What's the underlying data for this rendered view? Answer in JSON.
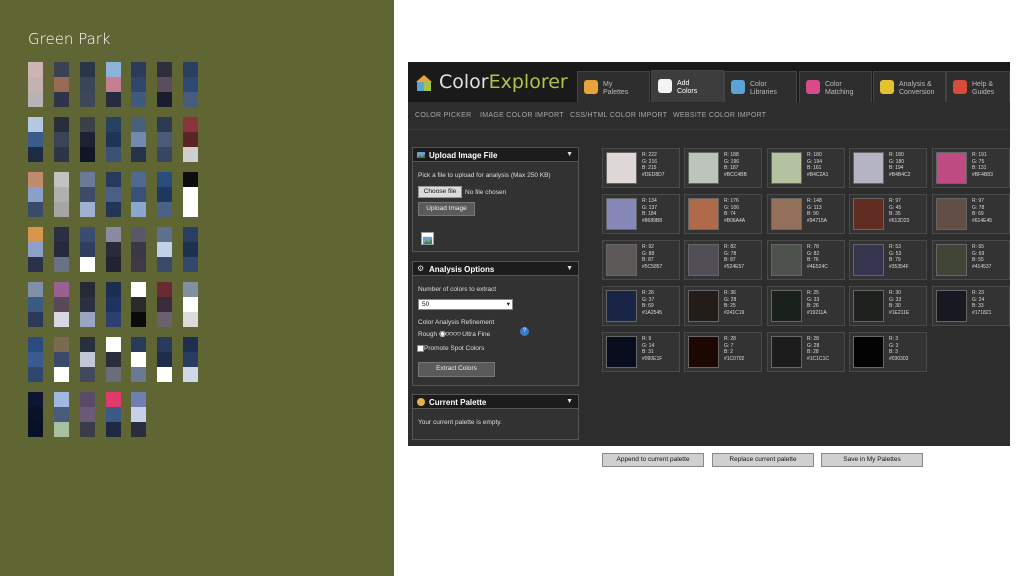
{
  "left_panel": {
    "title": "Green Park",
    "background": "#606534",
    "columns": [
      [
        "#cfb3b3",
        "#c3b2b1",
        "#b7b2b4",
        "#0f1530",
        "#171d3a"
      ],
      [
        "#3a4152",
        "#9a6a55",
        "#2f3549",
        "#30384c",
        "#2a2f40"
      ],
      [
        "#2a3545",
        "#3a4556",
        "#3d4758",
        "#3b3a48",
        "#3f3c4a"
      ],
      [
        "#8db3d8",
        "#c47f93",
        "#262c3e",
        "#ffffff",
        "#f5f5f5"
      ],
      [
        "#2d3a5a",
        "#30466c",
        "#405a7e",
        "#8a8070",
        "#8e8574"
      ],
      [
        "#2d2f3d",
        "#5a4d5d",
        "#1a1e2c",
        "#a28a9a",
        "#9e8898"
      ],
      [
        "#2a3e60",
        "#2c4a73",
        "#495b7c",
        "#f0f0f0",
        "#ececec"
      ],
      [
        "#b5c8e0",
        "#3b5b8c",
        "#1d2b45",
        "#2a3a55",
        "#0d1526"
      ],
      [
        "#2a2e38",
        "#3a4458",
        "#2e3646",
        "#4a5568",
        "#a8b0c0"
      ],
      [
        "#3c4148",
        "#1b2236",
        "#0f1726",
        "#ffffff",
        "#fafafa"
      ],
      [
        "#284064",
        "#1f3555",
        "#3a5275",
        "#162843",
        "#0f1c30"
      ],
      [
        "#4a5f7a",
        "#708ab0",
        "#253448",
        "#1c2738",
        "#2b3a52"
      ],
      [
        "#2e3a50",
        "#4a5a78",
        "#38465f",
        "#6d7a92",
        "#5f6b82"
      ],
      [
        "#8a3338",
        "#5a2429",
        "#cfcfcf",
        "#222222",
        "#1d1d1d"
      ],
      [
        "#c08a6e",
        "#8aa0c8",
        "#3a4a6a",
        "#283448",
        "#1f2a3e"
      ],
      [
        "#c2c2c2",
        "#b0b0b0",
        "#a5a5a5",
        "#1e2432",
        "#161b28"
      ],
      [
        "#6c7a98",
        "#3f4a68",
        "#9fb0d0",
        "#24324c",
        "#1c283e"
      ],
      [
        "#273a5e",
        "#4a5f88",
        "#233557",
        "#ffffff",
        "#f7f7f7"
      ],
      [
        "#4f6a92",
        "#3b5078",
        "#8aa7d0",
        "#0f1a2c",
        "#0b1322"
      ],
      [
        "#284d7a",
        "#1d3a5e",
        "#4a6285",
        "#ffffff",
        "#fafafa"
      ],
      [
        "#0d0d0d",
        "#ffffff",
        "#ffffff",
        "#4a4f5e",
        "#3f4452"
      ],
      [
        "#d9944e",
        "#8ca0c8",
        "#2a3148",
        "#4a4f60",
        "#3f2a4a"
      ],
      [
        "#2a3042",
        "#252a3a",
        "#6c7286",
        "#6a7084",
        "#4a5064"
      ],
      [
        "#3a4d70",
        "#2d3e5e",
        "#ffffff",
        "#2a3854",
        "#1c2a44"
      ],
      [
        "#8a8aa0",
        "#2a2a3a",
        "#222232",
        "#5a4a5a",
        "#7a6a7a"
      ],
      [
        "#5a5868",
        "#3a3848",
        "#403a48",
        "#46404e",
        "#4c4656"
      ],
      [
        "#5e7090",
        "#c0d2e6",
        "#3a4a68",
        "#2a3654",
        "#1e2a46"
      ],
      [
        "#2a3e64",
        "#1e3050",
        "#34476c",
        "#e8e8e8",
        "#e0e0e0"
      ],
      [
        "#8090a8",
        "#3a5a82",
        "#2a3a58",
        "#1e3252",
        "#6a7490"
      ],
      [
        "#9a6090",
        "#58485a",
        "#d8d8e0",
        "#8c8ca0",
        "#ffffff"
      ],
      [
        "#262a36",
        "#2a3040",
        "#9aa5c4",
        "#40485c",
        "#525a70"
      ],
      [
        "#1a2e52",
        "#1e3460",
        "#2d4070",
        "#1a2a48",
        "#15233e"
      ],
      [
        "#ffffff",
        "#2a2a2a",
        "#0a0a0a",
        "#080808",
        "#050505"
      ],
      [
        "#6a2a32",
        "#3a2a3a",
        "#6a6070",
        "#2a2a38",
        "#222230"
      ],
      [
        "#8090a0",
        "#ffffff",
        "#dcdcdc",
        "#2a3040",
        "#202634"
      ],
      [
        "#2a4a80",
        "#3a5a90",
        "#2e4670",
        "#45506a",
        "#3a4560"
      ],
      [
        "#7a6a50",
        "#3a4a6a",
        "#ffffff",
        "#fafafa",
        "#f5f5f5"
      ],
      [
        "#283040",
        "#c0c8d8",
        "#404a5c",
        "#5a6070",
        "#505868"
      ],
      [
        "#ffffff",
        "#2a2e3a",
        "#6a6e7a",
        "#646874",
        "#5e626e"
      ],
      [
        "#2a3a5a",
        "#ffffff",
        "#6a7a90",
        "#b0b8c8",
        "#a8b0c0"
      ],
      [
        "#2a3a5c",
        "#1f2d4a",
        "#ffffff",
        "#e8f0e8",
        "#1a1a1a"
      ],
      [
        "#1e2e50",
        "#2a3c62",
        "#cfd8e8",
        "#2a2a2a",
        "#1a1a1a"
      ],
      [
        "#0d1530",
        "#0a1228",
        "#081024",
        "#060c1e",
        "#050a1a"
      ],
      [
        "#a0b8e0",
        "#4a5a7a",
        "#a8c0a0",
        "#b0c8a8",
        "#283848"
      ],
      [
        "#5a4a68",
        "#6a5a78",
        "#3a3a4a",
        "#5e5e6e",
        "#303848"
      ],
      [
        "#e03a6a",
        "#3a5a88",
        "#1e2a40",
        "#1a2438",
        "#161f32"
      ],
      [
        "#6e7fb0",
        "#c8d0e8",
        "#2a2e3a",
        "#262a36",
        "#22262f"
      ]
    ]
  },
  "app": {
    "brand_part1": "Color",
    "brand_part2": "Explorer",
    "brand_accent": "#b5c24a",
    "tabs": [
      {
        "label": "My\nPalettes",
        "icon": "palette-icon"
      },
      {
        "label": "Add\nColors",
        "icon": "brush-icon",
        "active": true
      },
      {
        "label": "Color\nLibraries",
        "icon": "library-icon"
      },
      {
        "label": "Color\nMatching",
        "icon": "flower-icon"
      },
      {
        "label": "Analysis &\nConversion",
        "icon": "conversion-icon"
      },
      {
        "label": "Help &\nGuides",
        "icon": "lifebuoy-icon"
      }
    ],
    "subnav": [
      "COLOR PICKER",
      "IMAGE COLOR IMPORT",
      "CSS/HTML COLOR IMPORT",
      "WEBSITE COLOR IMPORT"
    ],
    "upload_panel": {
      "title": "Upload Image File",
      "instructions": "Pick a file to upload for analysis (Max 250 KB)",
      "choose_label": "Choose file",
      "no_file": "No file chosen",
      "upload_label": "Upload Image"
    },
    "analysis_panel": {
      "title": "Analysis Options",
      "count_label": "Number of colors to extract",
      "count_value": "50",
      "refinement_label": "Color Analysis Refinement",
      "rough_label": "Rough",
      "fine_label": "Ultra Fine",
      "promote_label": "Promote Spot Colors",
      "extract_label": "Extract Colors"
    },
    "palette_panel": {
      "title": "Current Palette",
      "empty_text": "Your current palette is empty."
    },
    "swatches": [
      {
        "hex": "#DED8D7",
        "r": 222,
        "g": 216,
        "b": 215
      },
      {
        "hex": "#BCC4BB",
        "r": 188,
        "g": 196,
        "b": 187
      },
      {
        "hex": "#B4C2A1",
        "r": 180,
        "g": 194,
        "b": 161
      },
      {
        "hex": "#B4B4C2",
        "r": 180,
        "g": 180,
        "b": 194
      },
      {
        "hex": "#BF4B83",
        "r": 191,
        "g": 75,
        "b": 131
      },
      {
        "hex": "#8689B8",
        "r": 134,
        "g": 137,
        "b": 184
      },
      {
        "hex": "#B06A4A",
        "r": 176,
        "g": 106,
        "b": 74
      },
      {
        "hex": "#94715A",
        "r": 148,
        "g": 113,
        "b": 90
      },
      {
        "hex": "#612D23",
        "r": 97,
        "g": 45,
        "b": 35
      },
      {
        "hex": "#614E45",
        "r": 97,
        "g": 78,
        "b": 69
      },
      {
        "hex": "#5C5857",
        "r": 92,
        "g": 88,
        "b": 87
      },
      {
        "hex": "#524E57",
        "r": 82,
        "g": 78,
        "b": 87
      },
      {
        "hex": "#4E524C",
        "r": 78,
        "g": 82,
        "b": 76
      },
      {
        "hex": "#35354F",
        "r": 53,
        "g": 53,
        "b": 79
      },
      {
        "hex": "#414537",
        "r": 65,
        "g": 69,
        "b": 55
      },
      {
        "hex": "#1A2545",
        "r": 26,
        "g": 37,
        "b": 69
      },
      {
        "hex": "#241C19",
        "r": 36,
        "g": 28,
        "b": 25
      },
      {
        "hex": "#19211A",
        "r": 25,
        "g": 33,
        "b": 26
      },
      {
        "hex": "#1E211E",
        "r": 30,
        "g": 33,
        "b": 30
      },
      {
        "hex": "#171821",
        "r": 23,
        "g": 24,
        "b": 33
      },
      {
        "hex": "#090E1F",
        "r": 9,
        "g": 14,
        "b": 31
      },
      {
        "hex": "#1C0702",
        "r": 28,
        "g": 7,
        "b": 2
      },
      {
        "hex": "#1C1C1C",
        "r": 28,
        "g": 28,
        "b": 28
      },
      {
        "hex": "#030303",
        "r": 3,
        "g": 3,
        "b": 3
      }
    ],
    "actions": [
      "Append to current palette",
      "Replace current palette",
      "Save in My Palettes"
    ]
  }
}
